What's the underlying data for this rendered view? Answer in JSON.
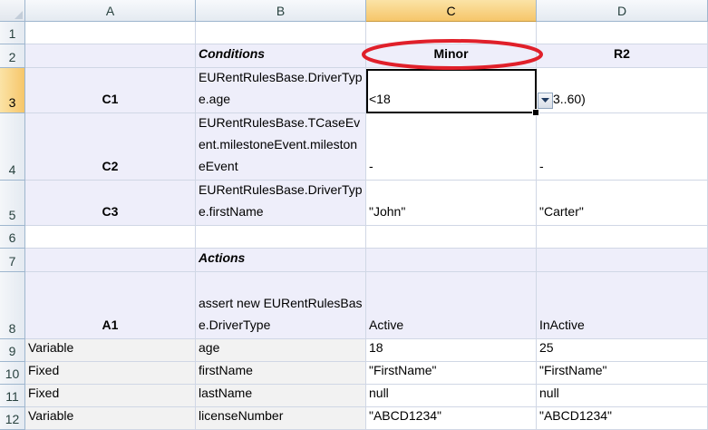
{
  "columns": [
    "A",
    "B",
    "C",
    "D"
  ],
  "rows": [
    "1",
    "2",
    "3",
    "4",
    "5",
    "6",
    "7",
    "8",
    "9",
    "10",
    "11",
    "12"
  ],
  "header_row": {
    "conditions": "Conditions",
    "minor": "Minor",
    "r2": "R2"
  },
  "condition_rows": [
    {
      "id": "C1",
      "expr": "EURentRulesBase.DriverType.age",
      "minor": "<18",
      "r2": "3..60)"
    },
    {
      "id": "C2",
      "expr": "EURentRulesBase.TCaseEvent.milestoneEvent.milestoneEvent",
      "minor": "-",
      "r2": "-"
    },
    {
      "id": "C3",
      "expr": "EURentRulesBase.DriverType.firstName",
      "minor": "\"John\"",
      "r2": "\"Carter\""
    }
  ],
  "actions_label": "Actions",
  "action_row": {
    "id": "A1",
    "expr": "assert new EURentRulesBase.DriverType",
    "minor": "Active",
    "r2": "InActive"
  },
  "field_rows": [
    {
      "kind": "Variable",
      "field": "age",
      "minor": "18",
      "r2": "25"
    },
    {
      "kind": "Fixed",
      "field": "firstName",
      "minor": "\"FirstName\"",
      "r2": "\"FirstName\""
    },
    {
      "kind": "Fixed",
      "field": "lastName",
      "minor": "null",
      "r2": "null"
    },
    {
      "kind": "Variable",
      "field": "licenseNumber",
      "minor": "\"ABCD1234\"",
      "r2": "\"ABCD1234\""
    }
  ],
  "colors": {
    "highlight_ellipse": "#e0202a",
    "selected_header": "#f6c66a",
    "lavender": "#eeeefa"
  },
  "icons": {
    "dropdown": "chevron-down-icon"
  }
}
